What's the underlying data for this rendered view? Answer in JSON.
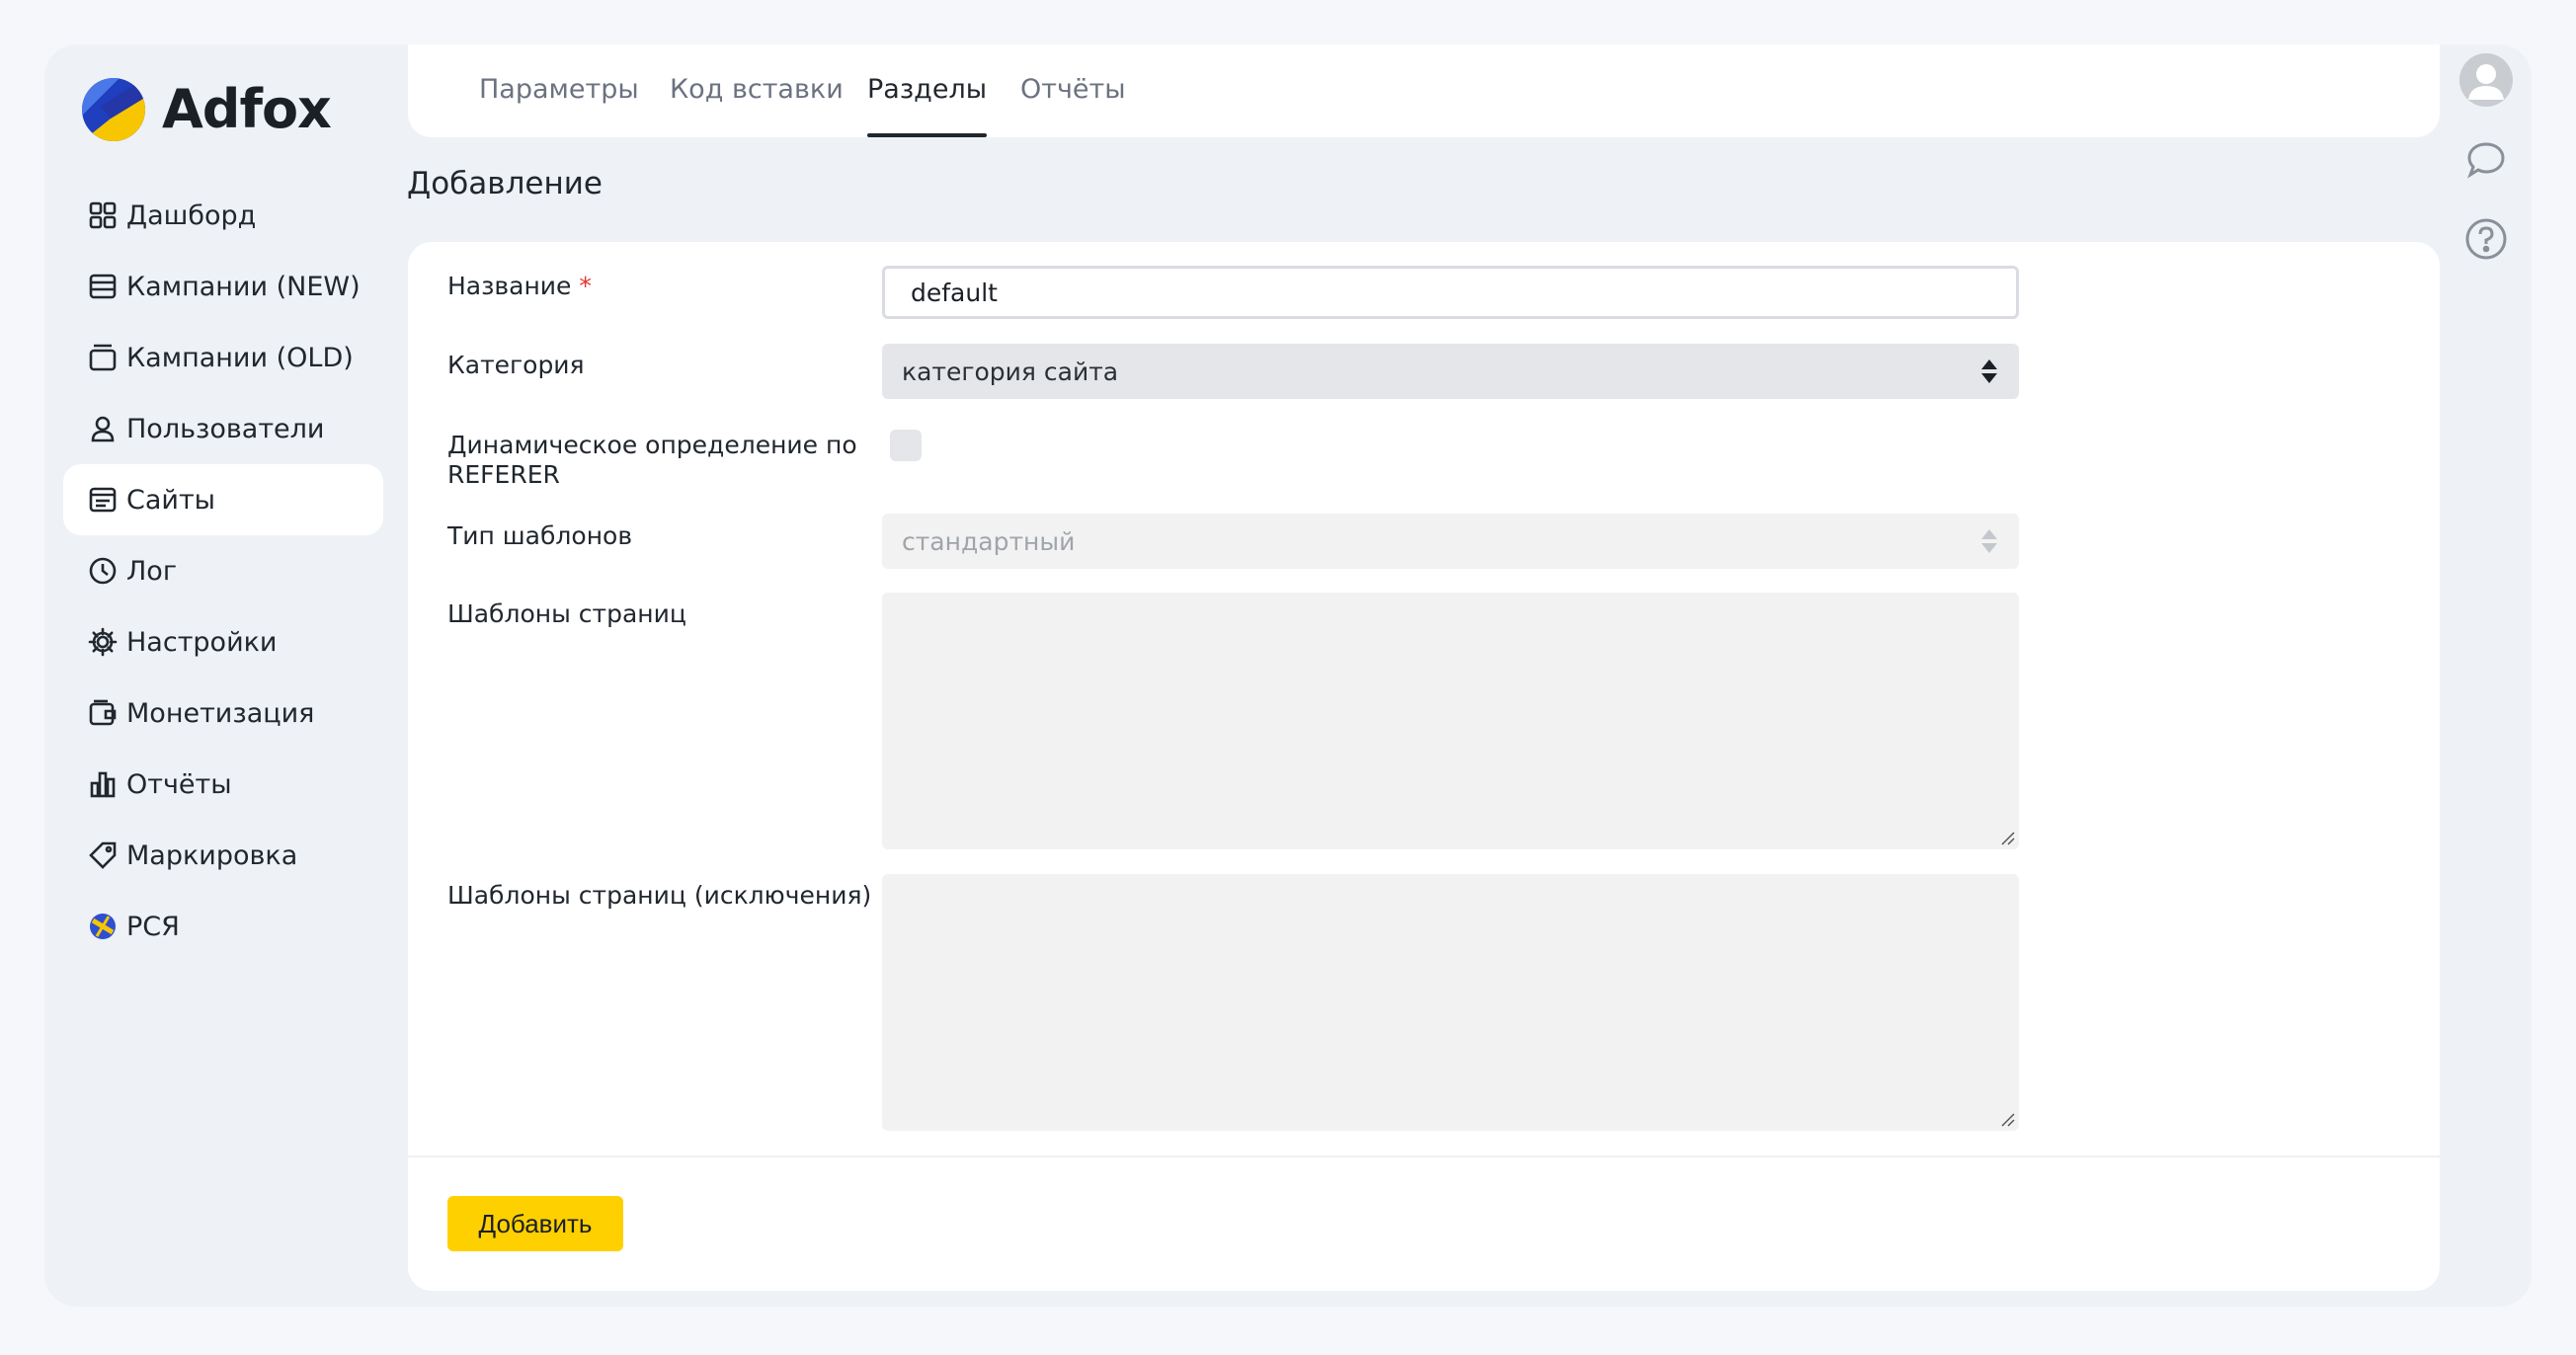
{
  "app": {
    "name": "Adfox"
  },
  "sidebar": {
    "items": [
      {
        "label": "Дашборд",
        "icon": "dashboard-icon"
      },
      {
        "label": "Кампании (NEW)",
        "icon": "campaigns-new-icon"
      },
      {
        "label": "Кампании (OLD)",
        "icon": "campaigns-old-icon"
      },
      {
        "label": "Пользователи",
        "icon": "user-icon"
      },
      {
        "label": "Сайты",
        "icon": "sites-icon",
        "active": true
      },
      {
        "label": "Лог",
        "icon": "clock-icon"
      },
      {
        "label": "Настройки",
        "icon": "gear-icon"
      },
      {
        "label": "Монетизация",
        "icon": "wallet-icon"
      },
      {
        "label": "Отчёты",
        "icon": "bar-chart-icon"
      },
      {
        "label": "Маркировка",
        "icon": "tag-icon"
      },
      {
        "label": "РСЯ",
        "icon": "rsya-logo-icon"
      }
    ]
  },
  "tabs": [
    {
      "label": "Параметры"
    },
    {
      "label": "Код вставки"
    },
    {
      "label": "Разделы",
      "active": true
    },
    {
      "label": "Отчёты"
    }
  ],
  "page": {
    "title": "Добавление"
  },
  "form": {
    "name_label": "Название",
    "required_mark": "*",
    "name_value": "default",
    "category_label": "Категория",
    "category_value": "категория сайта",
    "dynamic_label_line1": "Динамическое определение по",
    "dynamic_label_line2": "REFERER",
    "dynamic_checked": false,
    "template_type_label": "Тип шаблонов",
    "template_type_value": "стандартный",
    "page_templates_label": "Шаблоны страниц",
    "page_templates_value": "",
    "page_templates_exclusions_label": "Шаблоны страниц (исключения)",
    "page_templates_exclusions_value": "",
    "submit_label": "Добавить"
  },
  "colors": {
    "accent_button": "#ffd000",
    "background": "#eef1f6",
    "card": "#ffffff",
    "required": "#e3342f"
  }
}
